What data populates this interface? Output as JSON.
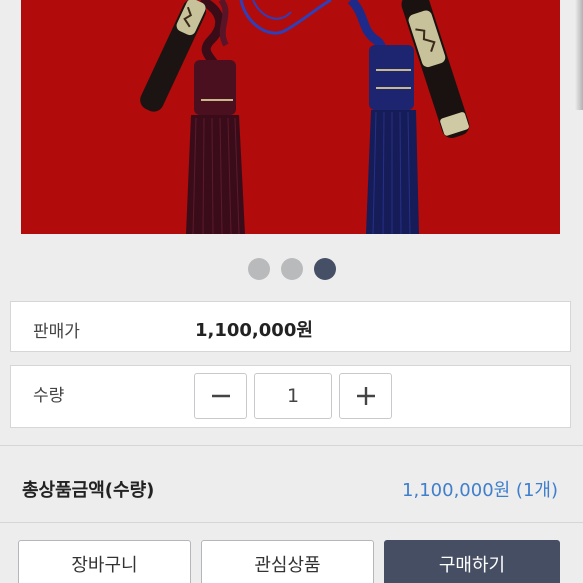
{
  "product": {
    "image_icon": "norigae-tassel-photo",
    "carousel": {
      "count": 3,
      "active_index": 2
    }
  },
  "price": {
    "label": "판매가",
    "value": "1,100,000원"
  },
  "quantity": {
    "label": "수량",
    "value": "1",
    "decrease_icon": "minus-icon",
    "increase_icon": "plus-icon"
  },
  "total": {
    "label": "총상품금액(수량)",
    "value": "1,100,000원 (1개)"
  },
  "actions": {
    "cart": "장바구니",
    "wishlist": "관심상품",
    "buy": "구매하기"
  },
  "colors": {
    "accent_blue": "#3f7fcc",
    "buy_button": "#464e63",
    "image_background": "#b10b0b"
  }
}
